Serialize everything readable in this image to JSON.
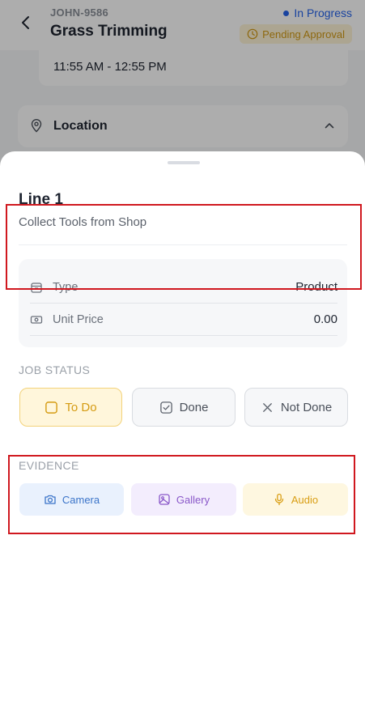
{
  "header": {
    "job_id": "JOHN-9586",
    "title": "Grass Trimming",
    "status": "In Progress",
    "approval": "Pending Approval",
    "status_color": "#2563eb",
    "approval_color": "#d19a16"
  },
  "schedule": {
    "time_range": "11:55 AM - 12:55 PM"
  },
  "location": {
    "label": "Location"
  },
  "sheet": {
    "line_title": "Line 1",
    "line_subtitle": "Collect Tools from Shop",
    "details": [
      {
        "label": "Type",
        "value": "Product",
        "icon": "box-icon"
      },
      {
        "label": "Unit Price",
        "value": "0.00",
        "icon": "cash-icon"
      }
    ],
    "job_status": {
      "title": "JOB STATUS",
      "options": [
        {
          "label": "To Do",
          "icon": "checkbox-empty-icon",
          "selected": true
        },
        {
          "label": "Done",
          "icon": "checkbox-checked-icon",
          "selected": false
        },
        {
          "label": "Not Done",
          "icon": "x-icon",
          "selected": false
        }
      ]
    },
    "evidence": {
      "title": "EVIDENCE",
      "options": [
        {
          "label": "Camera",
          "icon": "camera-icon",
          "color": "#3b74c9"
        },
        {
          "label": "Gallery",
          "icon": "image-icon",
          "color": "#8a58c9"
        },
        {
          "label": "Audio",
          "icon": "microphone-icon",
          "color": "#d99e14"
        }
      ]
    }
  },
  "highlight_color": "#d0181f"
}
